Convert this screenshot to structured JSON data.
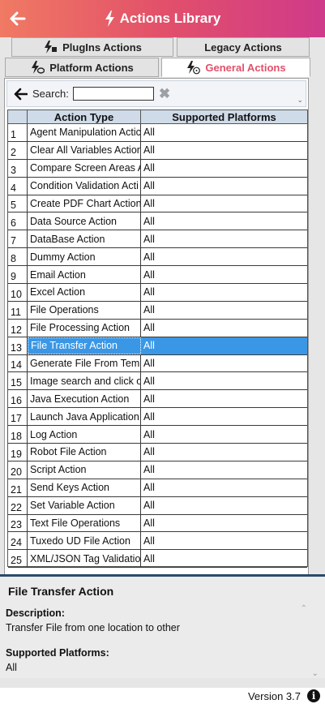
{
  "header": {
    "title": "Actions Library"
  },
  "tabs": {
    "plugins": "PlugIns Actions",
    "legacy": "Legacy Actions",
    "platform": "Platform Actions",
    "general": "General Actions"
  },
  "search": {
    "label": "Search:",
    "value": ""
  },
  "table": {
    "columns": [
      "Action Type",
      "Supported Platforms"
    ],
    "rows": [
      {
        "num": "1",
        "type": "Agent Manipulation Actic",
        "platforms": "All"
      },
      {
        "num": "2",
        "type": "Clear All Variables Action",
        "platforms": "All"
      },
      {
        "num": "3",
        "type": "Compare Screen Areas Ac",
        "platforms": "All"
      },
      {
        "num": "4",
        "type": "Condition Validation Acti",
        "platforms": "All"
      },
      {
        "num": "5",
        "type": "Create PDF Chart Action",
        "platforms": "All"
      },
      {
        "num": "6",
        "type": "Data Source Action",
        "platforms": "All"
      },
      {
        "num": "7",
        "type": "DataBase Action",
        "platforms": "All"
      },
      {
        "num": "8",
        "type": "Dummy Action",
        "platforms": "All"
      },
      {
        "num": "9",
        "type": "Email Action",
        "platforms": "All"
      },
      {
        "num": "10",
        "type": "Excel Action",
        "platforms": "All"
      },
      {
        "num": "11",
        "type": "File Operations",
        "platforms": "All"
      },
      {
        "num": "12",
        "type": "File Processing Action",
        "platforms": "All"
      },
      {
        "num": "13",
        "type": "File Transfer Action",
        "platforms": "All",
        "selected": true
      },
      {
        "num": "14",
        "type": "Generate File From Temp",
        "platforms": "All"
      },
      {
        "num": "15",
        "type": "Image search and click or",
        "platforms": "All"
      },
      {
        "num": "16",
        "type": "Java Execution Action",
        "platforms": "All"
      },
      {
        "num": "17",
        "type": "Launch Java Application",
        "platforms": "All"
      },
      {
        "num": "18",
        "type": "Log Action",
        "platforms": "All"
      },
      {
        "num": "19",
        "type": "Robot File Action",
        "platforms": "All"
      },
      {
        "num": "20",
        "type": "Script Action",
        "platforms": "All"
      },
      {
        "num": "21",
        "type": "Send Keys Action",
        "platforms": "All"
      },
      {
        "num": "22",
        "type": "Set Variable Action",
        "platforms": "All"
      },
      {
        "num": "23",
        "type": "Text File Operations",
        "platforms": "All"
      },
      {
        "num": "24",
        "type": "Tuxedo UD File Action",
        "platforms": "All"
      },
      {
        "num": "25",
        "type": "XML/JSON Tag Validation",
        "platforms": "All"
      }
    ]
  },
  "details": {
    "title": "File Transfer Action",
    "description_label": "Description:",
    "description": "Transfer File from one location to other",
    "platforms_label": "Supported Platforms:",
    "platforms": "All"
  },
  "footer": {
    "version": "Version 3.7"
  },
  "colors": {
    "header_start": "#f07a63",
    "header_end": "#cf3a8a",
    "accent": "#e2506a",
    "selection": "#3a97e6"
  },
  "icons": [
    "back-arrow-icon",
    "lightning-icon",
    "plugin-lightning-icon",
    "platform-lightning-icon",
    "general-lightning-icon",
    "clear-x-icon",
    "info-icon"
  ]
}
